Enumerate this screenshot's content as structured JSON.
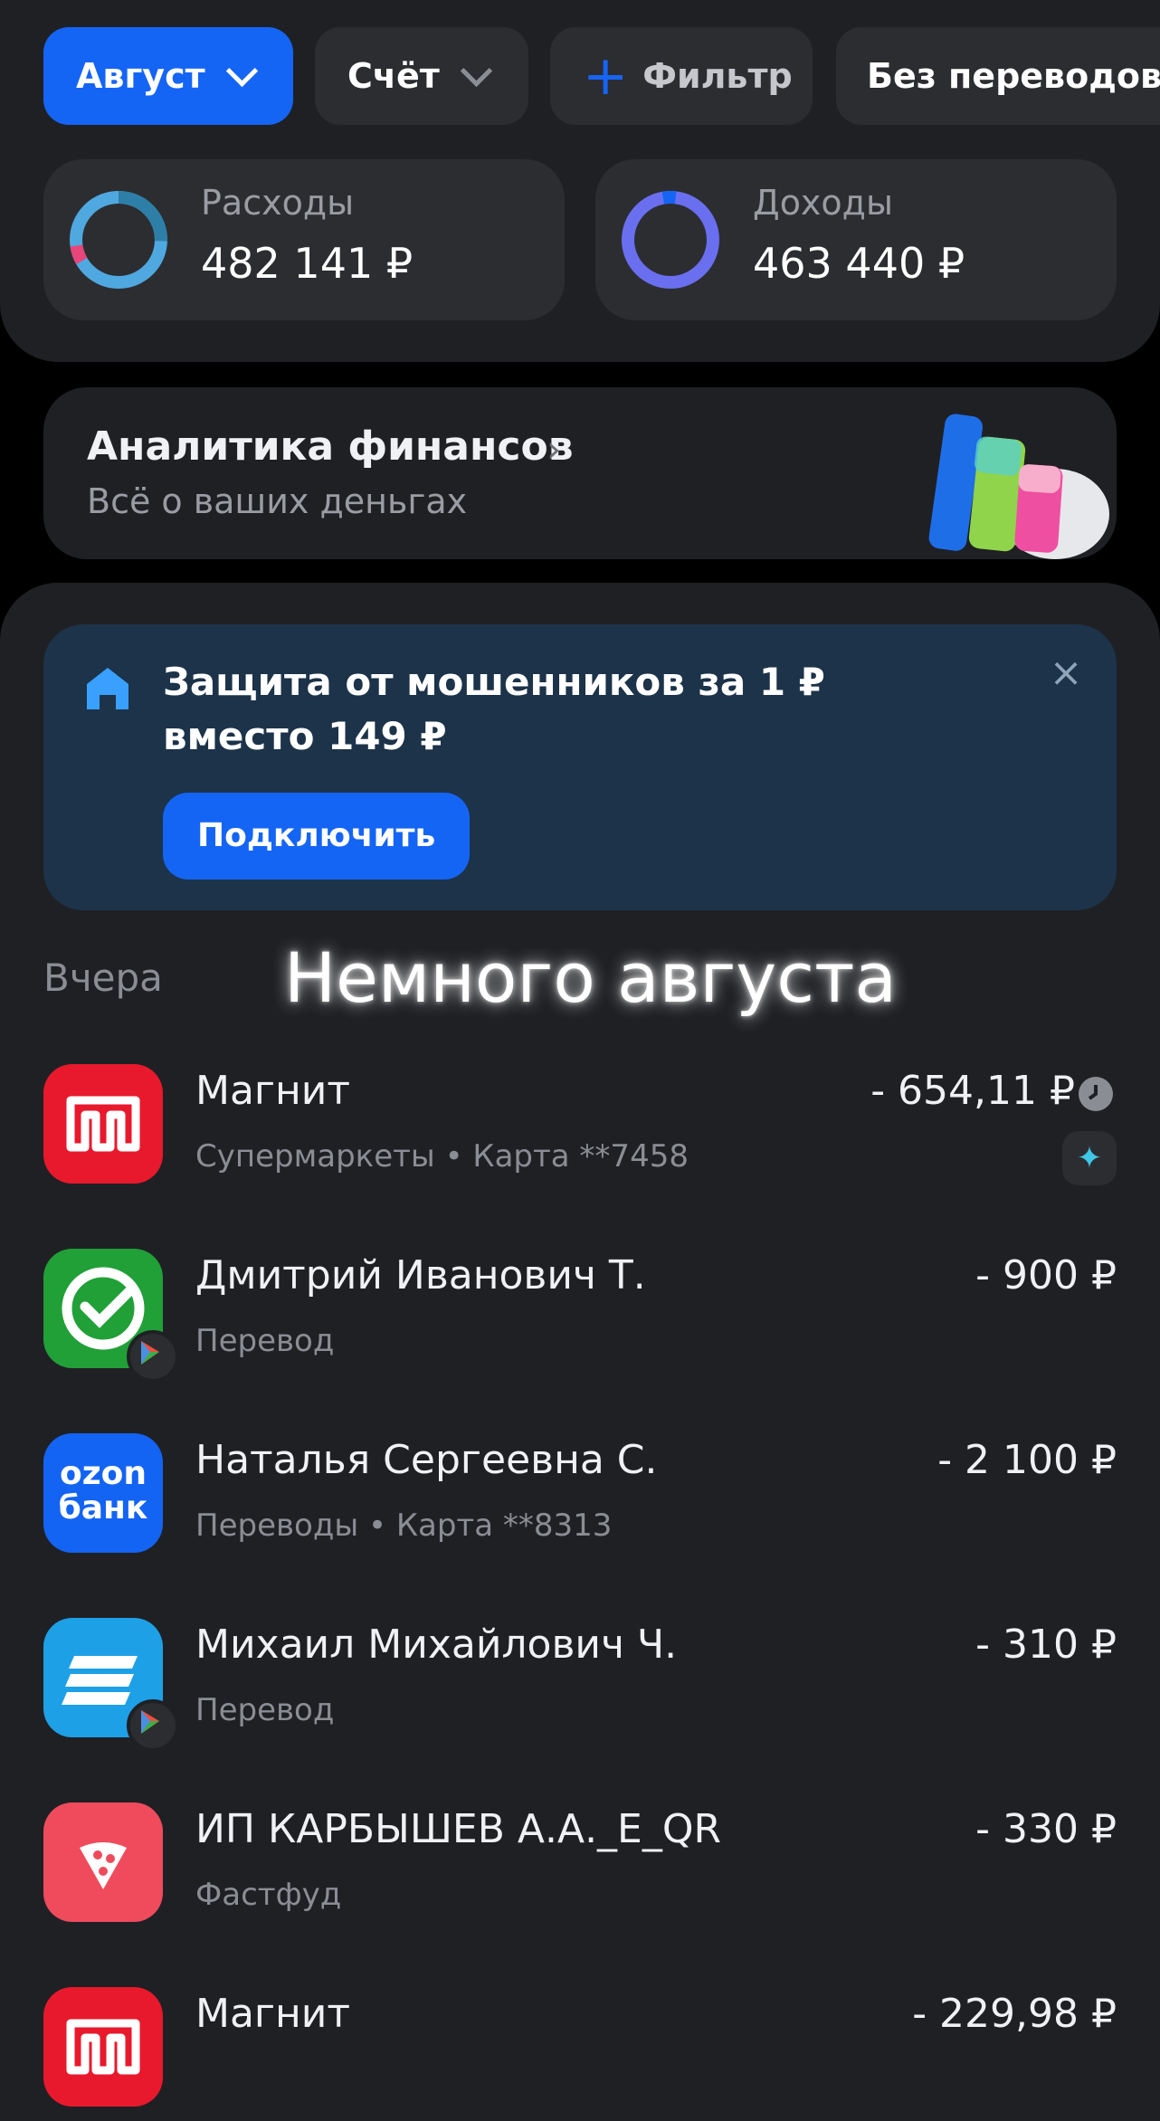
{
  "filters": {
    "month": "Август",
    "account": "Счёт",
    "filter": "Фильтр",
    "no_transfers": "Без переводов"
  },
  "stats": {
    "expenses": {
      "label": "Расходы",
      "value": "482 141 ₽"
    },
    "income": {
      "label": "Доходы",
      "value": "463 440 ₽"
    }
  },
  "analytics": {
    "title": "Аналитика финансов",
    "subtitle": "Всё о ваших деньгах"
  },
  "promo": {
    "title_line1": "Защита от мошенников за 1 ₽",
    "title_line2": "вместо 149 ₽",
    "button": "Подключить",
    "close": "×"
  },
  "section": {
    "label": "Вчера",
    "overlay": "Немного августа"
  },
  "transactions": [
    {
      "name": "Магнит",
      "meta": "Супермаркеты • Карта **7458",
      "amount": "- 654,11 ₽",
      "logo": "magnit-logo"
    },
    {
      "name": "Дмитрий Иванович Т.",
      "meta": "Перевод",
      "amount": "- 900 ₽",
      "logo": "sber-logo"
    },
    {
      "name": "Наталья Сергеевна С.",
      "meta": "Переводы • Карта **8313",
      "amount": "- 2 100 ₽",
      "logo": "ozon-bank-logo",
      "logo_text_1": "ozon",
      "logo_text_2": "банк"
    },
    {
      "name": "Михаил Михайлович Ч.",
      "meta": "Перевод",
      "amount": "- 310 ₽",
      "logo": "bank-logo"
    },
    {
      "name": "ИП КАРБЫШЕВ А.А._E_QR",
      "meta": "Фастфуд",
      "amount": "- 330 ₽",
      "logo": "pizza-logo"
    },
    {
      "name": "Магнит",
      "meta": "",
      "amount": "- 229,98 ₽",
      "logo": "magnit-logo"
    }
  ],
  "colors": {
    "accent": "#1565f5",
    "expenses_ring": "#4fa8e0",
    "income_ring": "#6a6ff0",
    "magnit": "#e8192c",
    "sber": "#21a038",
    "ozon": "#1464f4",
    "pizza": "#ef4b5c",
    "promo_bg": "#1c3349"
  }
}
